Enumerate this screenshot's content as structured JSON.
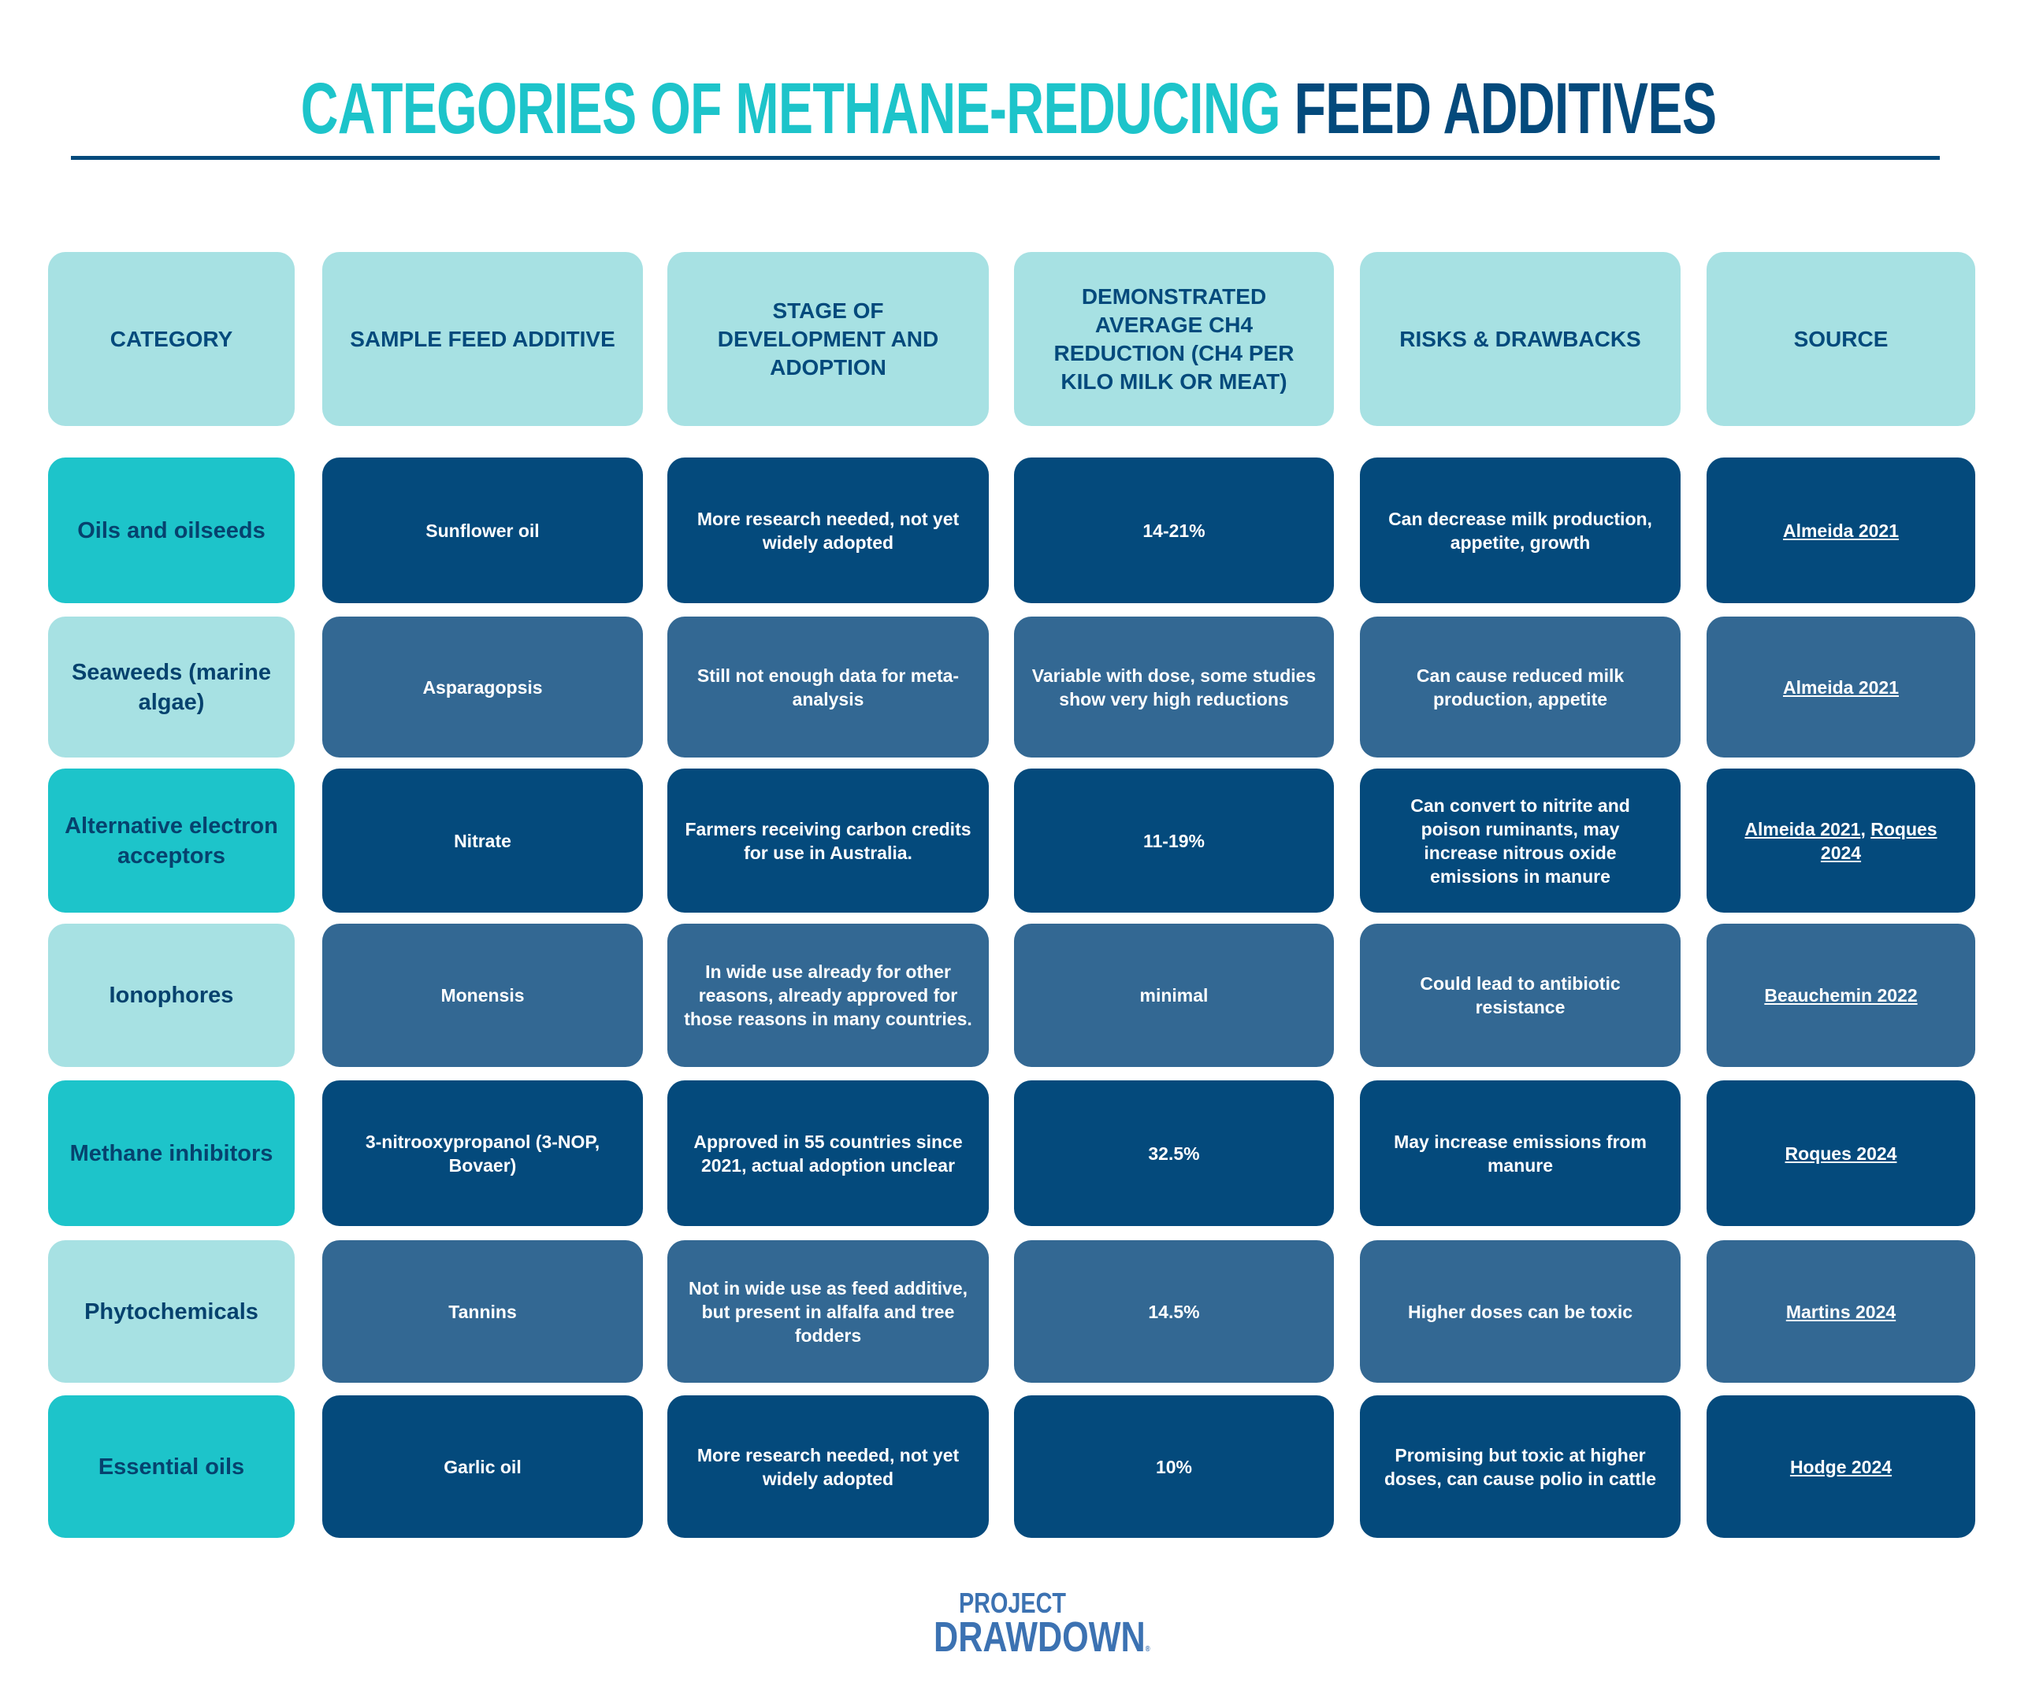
{
  "title": {
    "part1": "CATEGORIES OF METHANE-REDUCING",
    "part2": "FEED ADDITIVES"
  },
  "colors": {
    "teal": "#1dc4ca",
    "light_teal": "#a7e1e3",
    "navy": "#044a7c",
    "mid_blue": "#336893"
  },
  "table": {
    "headers": [
      "CATEGORY",
      "SAMPLE FEED ADDITIVE",
      "STAGE OF DEVELOPMENT AND ADOPTION",
      "DEMONSTRATED AVERAGE CH4 REDUCTION (CH4 PER KILO MILK OR MEAT)",
      "RISKS & DRAWBACKS",
      "SOURCE"
    ],
    "rows": [
      {
        "category": "Oils and oilseeds",
        "additive": "Sunflower oil",
        "stage": "More research needed, not yet widely adopted",
        "reduction": "14-21%",
        "risks": "Can decrease milk production, appetite, growth",
        "sources": [
          "Almeida 2021"
        ]
      },
      {
        "category": "Seaweeds (marine algae)",
        "additive": "Asparagopsis",
        "stage": "Still not enough data for meta-analysis",
        "reduction": "Variable with dose, some studies show very high reductions",
        "risks": "Can cause reduced milk production, appetite",
        "sources": [
          "Almeida 2021"
        ]
      },
      {
        "category": "Alternative electron acceptors",
        "additive": "Nitrate",
        "stage": "Farmers receiving carbon credits for use in Australia.",
        "reduction": "11-19%",
        "risks": "Can convert to nitrite and poison ruminants, may increase nitrous oxide emissions in manure",
        "sources": [
          "Almeida 2021",
          "Roques 2024"
        ]
      },
      {
        "category": "Ionophores",
        "additive": "Monensis",
        "stage": "In wide use already for other reasons, already approved for those reasons in many countries.",
        "reduction": "minimal",
        "risks": "Could lead to antibiotic resistance",
        "sources": [
          "Beauchemin 2022"
        ]
      },
      {
        "category": "Methane inhibitors",
        "additive": "3-nitrooxypropanol (3-NOP, Bovaer)",
        "stage": "Approved in 55 countries since 2021, actual adoption unclear",
        "reduction": "32.5%",
        "risks": "May increase emissions from manure",
        "sources": [
          "Roques 2024"
        ]
      },
      {
        "category": "Phytochemicals",
        "additive": "Tannins",
        "stage": "Not in wide use as feed additive, but present in alfalfa and tree fodders",
        "reduction": "14.5%",
        "risks": "Higher doses can be toxic",
        "sources": [
          "Martins 2024"
        ]
      },
      {
        "category": "Essential oils",
        "additive": "Garlic oil",
        "stage": "More research needed, not yet widely adopted",
        "reduction": "10%",
        "risks": "Promising but toxic at higher doses, can cause polio in cattle",
        "sources": [
          "Hodge 2024"
        ]
      }
    ],
    "source_separator": ", "
  },
  "logo": {
    "line1": "PROJECT",
    "line2": "DRAWDOWN",
    "mark": "®"
  }
}
